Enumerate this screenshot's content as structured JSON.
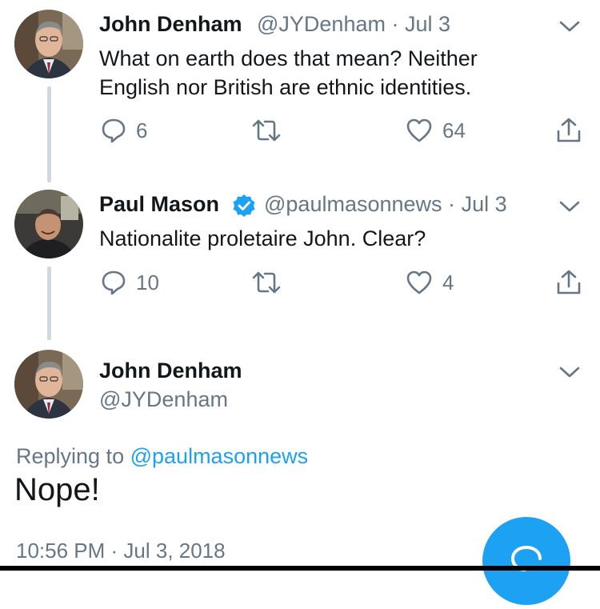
{
  "tweets": [
    {
      "name": "John Denham",
      "handle": "@JYDenham",
      "sep": "·",
      "date": "Jul 3",
      "text_line1": "What on earth does that mean? Neither",
      "text_line2": "English nor British are ethnic identities.",
      "replies": "6",
      "likes": "64"
    },
    {
      "name": "Paul Mason",
      "handle": "@paulmasonnews",
      "sep": "·",
      "date": "Jul 3",
      "text": "Nationalite proletaire John. Clear?",
      "replies": "10",
      "likes": "4"
    }
  ],
  "focused": {
    "name": "John Denham",
    "handle": "@JYDenham",
    "replying_prefix": "Replying to",
    "replying_to": "@paulmasonnews",
    "text": "Nope!",
    "timestamp": "10:56 PM · Jul 3, 2018"
  },
  "icons": {
    "reply": "reply-icon",
    "retweet": "retweet-icon",
    "like": "heart-icon",
    "share": "share-icon",
    "caret": "chevron-down-icon",
    "verified": "verified-badge-icon",
    "compose": "compose-fab"
  },
  "colors": {
    "accent": "#1da1f2",
    "text": "#14171a",
    "muted": "#657786",
    "thread_line": "#cfd9de"
  }
}
